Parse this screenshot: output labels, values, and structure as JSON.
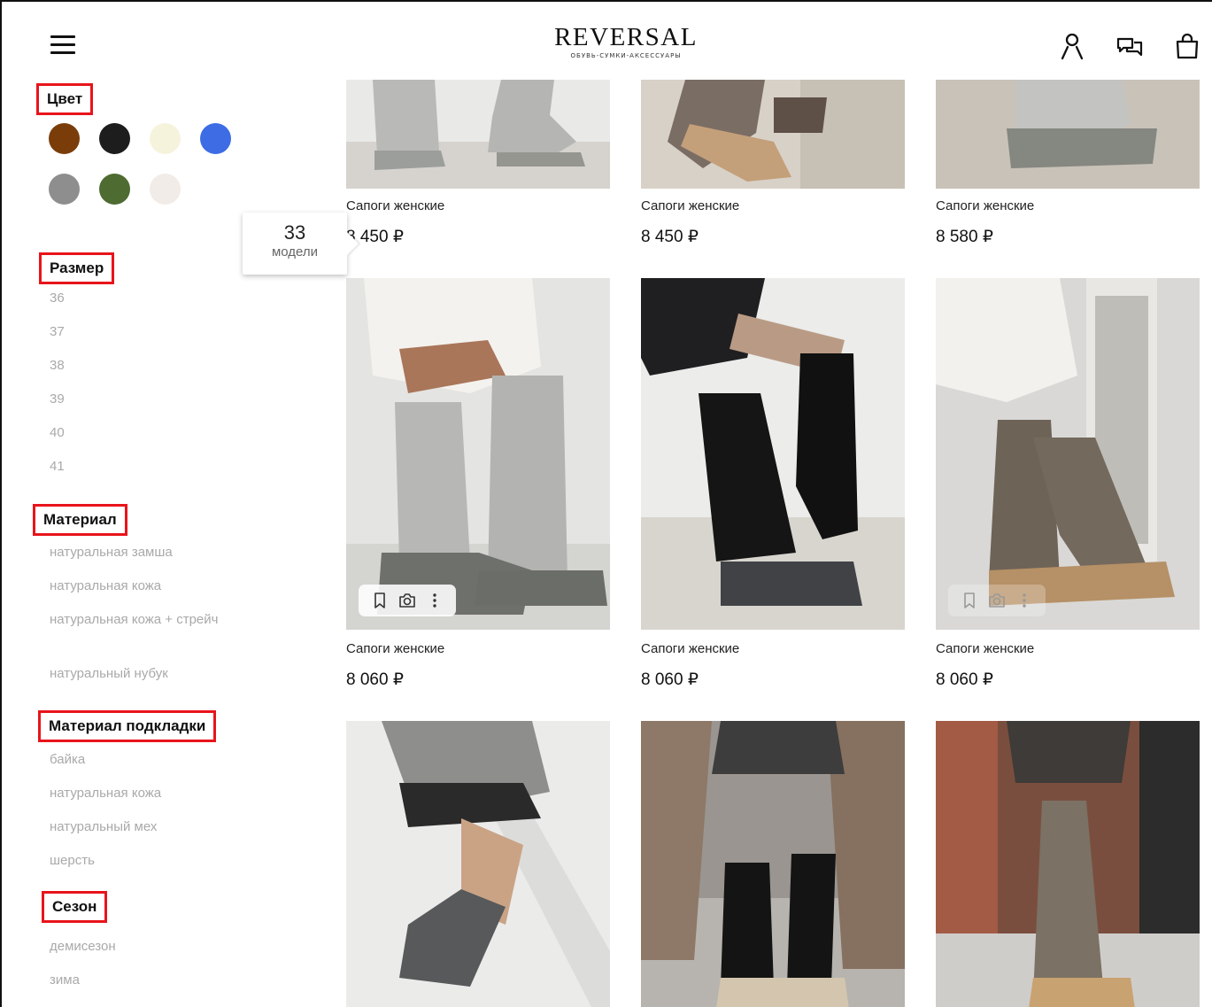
{
  "header": {
    "logo_title": "REVERSAL",
    "logo_subtitle": "ОБУВЬ-СУМКИ-АКСЕССУАРЫ",
    "icons": [
      "menu-icon",
      "user-icon",
      "chat-icon",
      "bag-icon"
    ]
  },
  "filters": {
    "color": {
      "title": "Цвет",
      "swatches": [
        "#7a3d0a",
        "#1d1d1d",
        "#f6f3dd",
        "#3d6ce5",
        "#8e8e8e",
        "#4e6b31",
        "#f1ece7"
      ]
    },
    "size": {
      "title": "Размер",
      "options": [
        "36",
        "37",
        "38",
        "39",
        "40",
        "41"
      ]
    },
    "material": {
      "title": "Материал",
      "options": [
        "натуральная замша",
        "натуральная кожа",
        "натуральная кожа + стрейч",
        "натуральный нубук"
      ]
    },
    "lining": {
      "title": "Материал подкладки",
      "options": [
        "байка",
        "натуральная кожа",
        "натуральный мех",
        "шерсть"
      ]
    },
    "season": {
      "title": "Сезон",
      "options": [
        "демисезон",
        "зима"
      ]
    }
  },
  "counter": {
    "count": "33",
    "label": "модели"
  },
  "products": [
    {
      "name": "Сапоги женские",
      "price": "8 450 ₽"
    },
    {
      "name": "Сапоги женские",
      "price": "8 450 ₽"
    },
    {
      "name": "Сапоги женские",
      "price": "8 580 ₽"
    },
    {
      "name": "Сапоги женские",
      "price": "8 060 ₽"
    },
    {
      "name": "Сапоги женские",
      "price": "8 060 ₽"
    },
    {
      "name": "Сапоги женские",
      "price": "8 060 ₽"
    },
    {
      "name": "",
      "price": ""
    },
    {
      "name": "",
      "price": ""
    },
    {
      "name": "",
      "price": ""
    }
  ],
  "colors": {
    "accent_border": "#e8141b",
    "muted_text": "#a9a9a9"
  }
}
